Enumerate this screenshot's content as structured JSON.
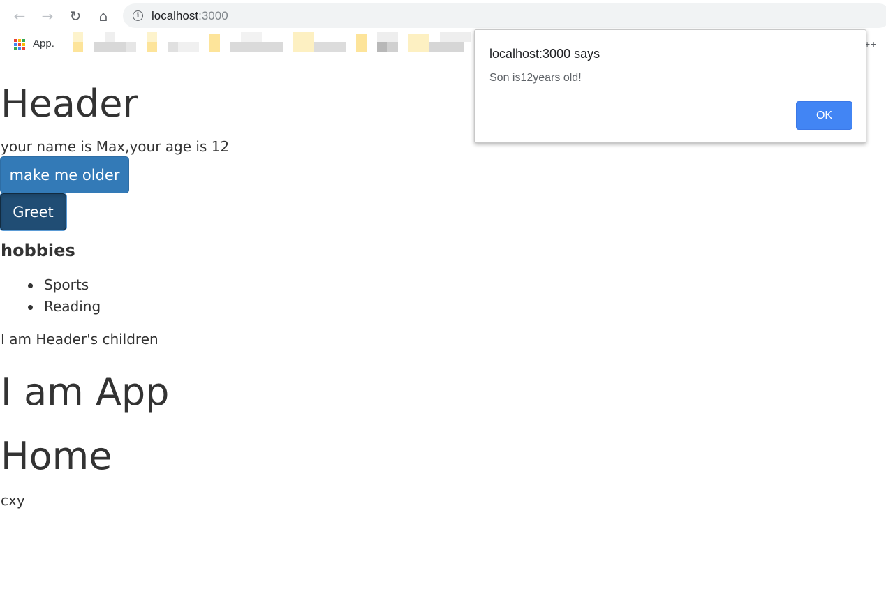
{
  "browser": {
    "url_host": "localhost",
    "url_port": ":3000",
    "back_glyph": "←",
    "forward_glyph": "→",
    "reload_glyph": "↻",
    "home_glyph": "⌂",
    "info_glyph": "i",
    "bookmarks": {
      "apps_label": "App.",
      "overflow_label": "++",
      "apps_icon_colors": [
        "#ea4335",
        "#fbbc05",
        "#34a853",
        "#4285f4",
        "#ea4335",
        "#fbbc05",
        "#34a853",
        "#4285f4",
        "#ea4335"
      ]
    }
  },
  "page": {
    "header_title": "Header",
    "info_text": "your name is Max,your age is 12",
    "make_older_label": "make me older",
    "greet_label": "Greet",
    "hobbies_title": "hobbies",
    "hobbies": [
      "Sports",
      "Reading"
    ],
    "children_text": "I am Header's children",
    "app_title": "I am App",
    "home_title": "Home",
    "home_text": "cxy"
  },
  "alert": {
    "title": "localhost:3000 says",
    "message": "Son is12years old!",
    "ok_label": "OK"
  },
  "colors": {
    "primary_button": "#337ab7",
    "greet_button_active": "#204d74",
    "alert_ok": "#4285f4",
    "text": "#333333"
  }
}
